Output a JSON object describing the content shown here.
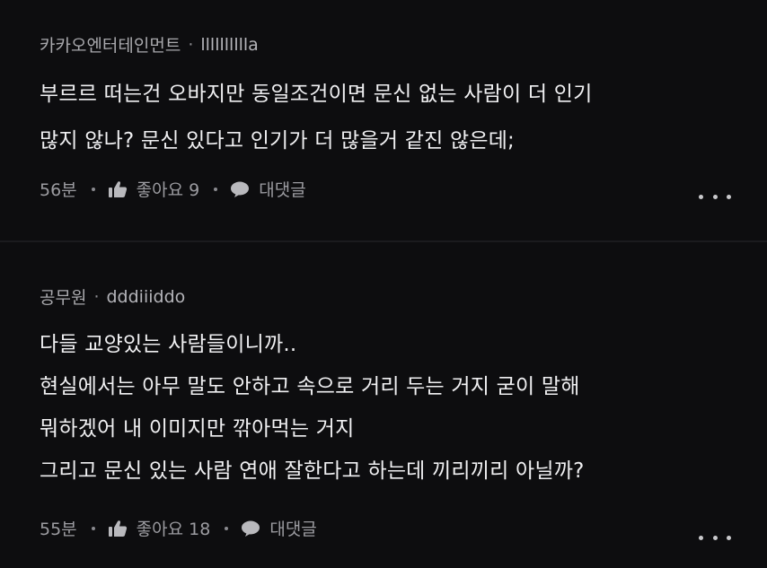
{
  "comments": [
    {
      "source": "카카오엔터테인먼트",
      "author": "lllllllllla",
      "lines": [
        "부르르 떠는건 오바지만 동일조건이면 문신 없는 사람이 더 인기",
        "많지 않나? 문신 있다고 인기가 더 많을거 같진 않은데;"
      ],
      "time": "56분",
      "like_label": "좋아요 9",
      "reply_label": "대댓글"
    },
    {
      "source": "공무원",
      "author": "dddiiiddo",
      "lines": [
        "다들 교양있는 사람들이니까..",
        "현실에서는 아무 말도 안하고 속으로 거리 두는 거지 굳이 말해",
        "뭐하겠어 내 이미지만 깎아먹는 거지",
        "그리고 문신 있는 사람 연애 잘한다고 하는데 끼리끼리 아닐까?"
      ],
      "time": "55분",
      "like_label": "좋아요 18",
      "reply_label": "대댓글"
    }
  ],
  "icons": {
    "like": "thumbs-up-icon",
    "reply": "speech-bubble-icon",
    "more": "more-dots-icon"
  },
  "colors": {
    "background": "#0d0d0f",
    "text": "#f0f0f2",
    "meta": "#a9a9ad"
  }
}
